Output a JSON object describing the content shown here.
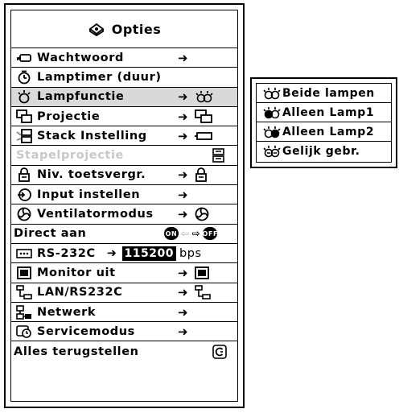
{
  "menu": {
    "title": "Opties",
    "items": [
      {
        "label": "Wachtwoord",
        "icon": "key-icon",
        "arrow": "➜"
      },
      {
        "label": "Lamptimer (duur)",
        "icon": "lamp-timer-icon"
      },
      {
        "label": "Lampfunctie",
        "icon": "lamp-icon",
        "arrow": "➜",
        "selected": true
      },
      {
        "label": "Projectie",
        "icon": "projection-icon",
        "arrow": "➜"
      },
      {
        "label": "Stack Instelling",
        "icon": "stack-icon",
        "arrow": "➜"
      },
      {
        "label": "Stapelprojectie",
        "icon": "stack-projection-icon",
        "disabled": true
      },
      {
        "label": "Niv. toetsvergr.",
        "icon": "lock-icon",
        "arrow": "➜"
      },
      {
        "label": "Input instellen",
        "icon": "input-icon",
        "arrow": "➜"
      },
      {
        "label": "Ventilatormodus",
        "icon": "fan-icon",
        "arrow": "➜"
      },
      {
        "label": "Direct aan",
        "on": "ON",
        "off": "OFF"
      },
      {
        "label": "RS-232C",
        "icon": "rs232c-icon",
        "arrow": "➜",
        "value": "115200",
        "unit": "bps"
      },
      {
        "label": "Monitor uit",
        "icon": "monitor-icon",
        "arrow": "➜"
      },
      {
        "label": "LAN/RS232C",
        "icon": "lan-icon",
        "arrow": "➜"
      },
      {
        "label": "Netwerk",
        "icon": "network-icon",
        "arrow": "➜"
      },
      {
        "label": "Servicemodus",
        "icon": "service-icon",
        "arrow": "➜"
      },
      {
        "label": "Alles terugstellen",
        "icon": "reset-icon"
      }
    ]
  },
  "submenu": {
    "items": [
      {
        "label": "Beide lampen"
      },
      {
        "label": "Alleen Lamp1"
      },
      {
        "label": "Alleen Lamp2"
      },
      {
        "label": "Gelijk gebr."
      }
    ]
  }
}
